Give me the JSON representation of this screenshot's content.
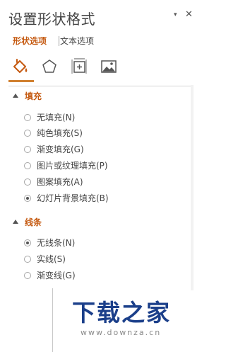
{
  "pane": {
    "title": "设置形状格式",
    "controls": {
      "dropdown_glyph": "▾",
      "close_glyph": "✕"
    }
  },
  "tabs": [
    {
      "label": "形状选项",
      "active": true
    },
    {
      "label": "文本选项",
      "active": false
    }
  ],
  "icons": [
    {
      "name": "fill-line-icon",
      "selected": true
    },
    {
      "name": "effects-icon",
      "selected": false
    },
    {
      "name": "size-properties-icon",
      "selected": false
    },
    {
      "name": "picture-icon",
      "selected": false
    }
  ],
  "sections": {
    "fill": {
      "header": "填充",
      "expanded": true,
      "options": [
        {
          "label": "无填充(N)",
          "checked": false
        },
        {
          "label": "纯色填充(S)",
          "checked": false
        },
        {
          "label": "渐变填充(G)",
          "checked": false
        },
        {
          "label": "图片或纹理填充(P)",
          "checked": false
        },
        {
          "label": "图案填充(A)",
          "checked": false
        },
        {
          "label": "幻灯片背景填充(B)",
          "checked": true
        }
      ]
    },
    "line": {
      "header": "线条",
      "expanded": true,
      "options": [
        {
          "label": "无线条(N)",
          "checked": true
        },
        {
          "label": "实线(S)",
          "checked": false
        },
        {
          "label": "渐变线(G)",
          "checked": false
        }
      ]
    }
  },
  "watermark": {
    "logo": "下载之家",
    "url": "www.downza.cn"
  },
  "colors": {
    "accent": "#c55a11",
    "text": "#444444",
    "watermark_logo": "#1b3f8a"
  }
}
